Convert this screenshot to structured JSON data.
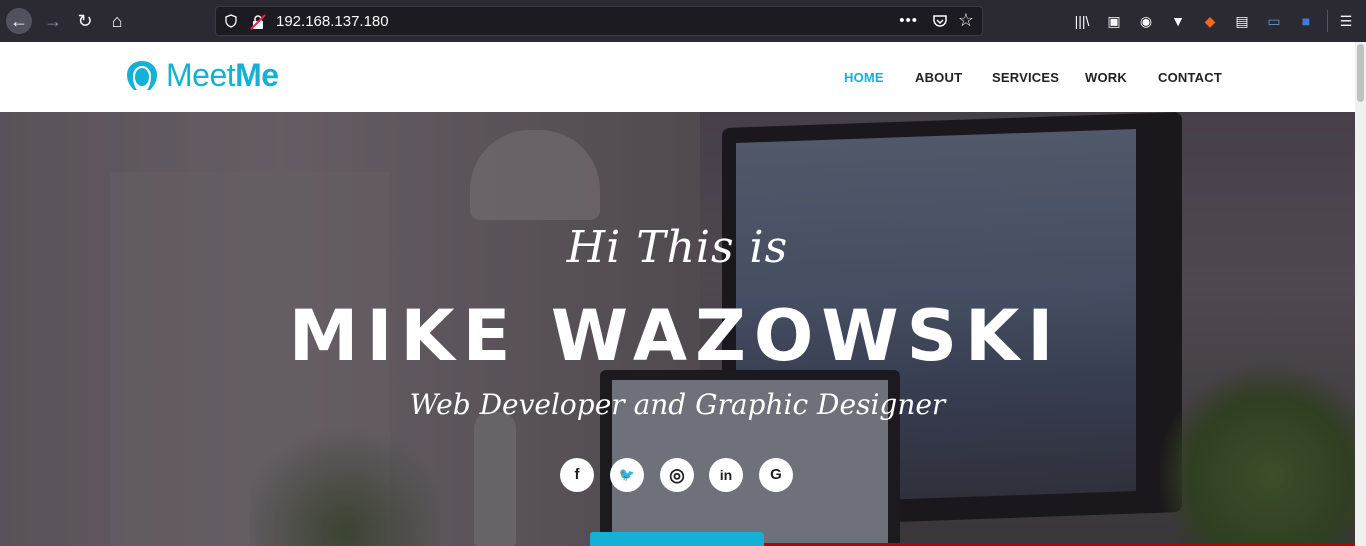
{
  "browser": {
    "url": "192.168.137.180",
    "page_actions": "•••"
  },
  "site": {
    "logo": {
      "part1": "Meet",
      "part2": "Me"
    },
    "nav": [
      {
        "label": "HOME",
        "active": true
      },
      {
        "label": "ABOUT",
        "active": false
      },
      {
        "label": "SERVICES",
        "active": false
      },
      {
        "label": "WORK",
        "active": false
      },
      {
        "label": "CONTACT",
        "active": false
      }
    ]
  },
  "hero": {
    "greeting": "Hi This is",
    "name": "MIKE WAZOWSKI",
    "role": "Web Developer and Graphic Designer",
    "socials": [
      {
        "icon": "facebook-icon",
        "glyph": "f"
      },
      {
        "icon": "twitter-icon",
        "glyph": "🐦"
      },
      {
        "icon": "instagram-icon",
        "glyph": "◎"
      },
      {
        "icon": "linkedin-icon",
        "glyph": "in"
      },
      {
        "icon": "google-icon",
        "glyph": "G"
      }
    ]
  },
  "colors": {
    "accent": "#15b0d6",
    "chrome_bg": "#2b2a33",
    "urlbar_bg": "#1c1b22"
  }
}
